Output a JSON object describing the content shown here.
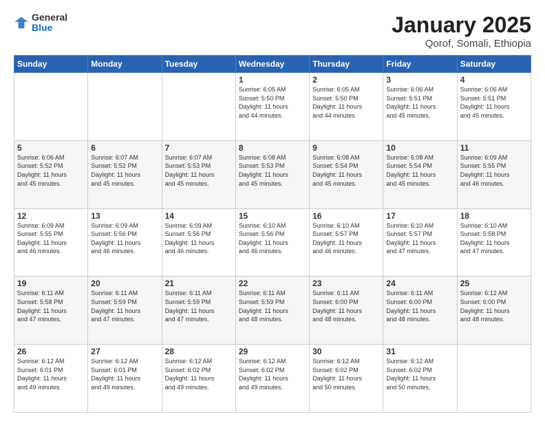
{
  "logo": {
    "general": "General",
    "blue": "Blue"
  },
  "title": "January 2025",
  "subtitle": "Qorof, Somali, Ethiopia",
  "header": {
    "days": [
      "Sunday",
      "Monday",
      "Tuesday",
      "Wednesday",
      "Thursday",
      "Friday",
      "Saturday"
    ]
  },
  "weeks": [
    [
      {
        "day": "",
        "info": ""
      },
      {
        "day": "",
        "info": ""
      },
      {
        "day": "",
        "info": ""
      },
      {
        "day": "1",
        "info": "Sunrise: 6:05 AM\nSunset: 5:50 PM\nDaylight: 11 hours\nand 44 minutes."
      },
      {
        "day": "2",
        "info": "Sunrise: 6:05 AM\nSunset: 5:50 PM\nDaylight: 11 hours\nand 44 minutes."
      },
      {
        "day": "3",
        "info": "Sunrise: 6:06 AM\nSunset: 5:51 PM\nDaylight: 11 hours\nand 45 minutes."
      },
      {
        "day": "4",
        "info": "Sunrise: 6:06 AM\nSunset: 5:51 PM\nDaylight: 11 hours\nand 45 minutes."
      }
    ],
    [
      {
        "day": "5",
        "info": "Sunrise: 6:06 AM\nSunset: 5:52 PM\nDaylight: 11 hours\nand 45 minutes."
      },
      {
        "day": "6",
        "info": "Sunrise: 6:07 AM\nSunset: 5:52 PM\nDaylight: 11 hours\nand 45 minutes."
      },
      {
        "day": "7",
        "info": "Sunrise: 6:07 AM\nSunset: 5:53 PM\nDaylight: 11 hours\nand 45 minutes."
      },
      {
        "day": "8",
        "info": "Sunrise: 6:08 AM\nSunset: 5:53 PM\nDaylight: 11 hours\nand 45 minutes."
      },
      {
        "day": "9",
        "info": "Sunrise: 6:08 AM\nSunset: 5:54 PM\nDaylight: 11 hours\nand 45 minutes."
      },
      {
        "day": "10",
        "info": "Sunrise: 6:08 AM\nSunset: 5:54 PM\nDaylight: 11 hours\nand 45 minutes."
      },
      {
        "day": "11",
        "info": "Sunrise: 6:09 AM\nSunset: 5:55 PM\nDaylight: 11 hours\nand 46 minutes."
      }
    ],
    [
      {
        "day": "12",
        "info": "Sunrise: 6:09 AM\nSunset: 5:55 PM\nDaylight: 11 hours\nand 46 minutes."
      },
      {
        "day": "13",
        "info": "Sunrise: 6:09 AM\nSunset: 5:56 PM\nDaylight: 11 hours\nand 46 minutes."
      },
      {
        "day": "14",
        "info": "Sunrise: 6:09 AM\nSunset: 5:56 PM\nDaylight: 11 hours\nand 46 minutes."
      },
      {
        "day": "15",
        "info": "Sunrise: 6:10 AM\nSunset: 5:56 PM\nDaylight: 11 hours\nand 46 minutes."
      },
      {
        "day": "16",
        "info": "Sunrise: 6:10 AM\nSunset: 5:57 PM\nDaylight: 11 hours\nand 46 minutes."
      },
      {
        "day": "17",
        "info": "Sunrise: 6:10 AM\nSunset: 5:57 PM\nDaylight: 11 hours\nand 47 minutes."
      },
      {
        "day": "18",
        "info": "Sunrise: 6:10 AM\nSunset: 5:58 PM\nDaylight: 11 hours\nand 47 minutes."
      }
    ],
    [
      {
        "day": "19",
        "info": "Sunrise: 6:11 AM\nSunset: 5:58 PM\nDaylight: 11 hours\nand 47 minutes."
      },
      {
        "day": "20",
        "info": "Sunrise: 6:11 AM\nSunset: 5:59 PM\nDaylight: 11 hours\nand 47 minutes."
      },
      {
        "day": "21",
        "info": "Sunrise: 6:11 AM\nSunset: 5:59 PM\nDaylight: 11 hours\nand 47 minutes."
      },
      {
        "day": "22",
        "info": "Sunrise: 6:11 AM\nSunset: 5:59 PM\nDaylight: 11 hours\nand 48 minutes."
      },
      {
        "day": "23",
        "info": "Sunrise: 6:11 AM\nSunset: 6:00 PM\nDaylight: 11 hours\nand 48 minutes."
      },
      {
        "day": "24",
        "info": "Sunrise: 6:11 AM\nSunset: 6:00 PM\nDaylight: 11 hours\nand 48 minutes."
      },
      {
        "day": "25",
        "info": "Sunrise: 6:12 AM\nSunset: 6:00 PM\nDaylight: 11 hours\nand 48 minutes."
      }
    ],
    [
      {
        "day": "26",
        "info": "Sunrise: 6:12 AM\nSunset: 6:01 PM\nDaylight: 11 hours\nand 49 minutes."
      },
      {
        "day": "27",
        "info": "Sunrise: 6:12 AM\nSunset: 6:01 PM\nDaylight: 11 hours\nand 49 minutes."
      },
      {
        "day": "28",
        "info": "Sunrise: 6:12 AM\nSunset: 6:02 PM\nDaylight: 11 hours\nand 49 minutes."
      },
      {
        "day": "29",
        "info": "Sunrise: 6:12 AM\nSunset: 6:02 PM\nDaylight: 11 hours\nand 49 minutes."
      },
      {
        "day": "30",
        "info": "Sunrise: 6:12 AM\nSunset: 6:02 PM\nDaylight: 11 hours\nand 50 minutes."
      },
      {
        "day": "31",
        "info": "Sunrise: 6:12 AM\nSunset: 6:02 PM\nDaylight: 11 hours\nand 50 minutes."
      },
      {
        "day": "",
        "info": ""
      }
    ]
  ]
}
